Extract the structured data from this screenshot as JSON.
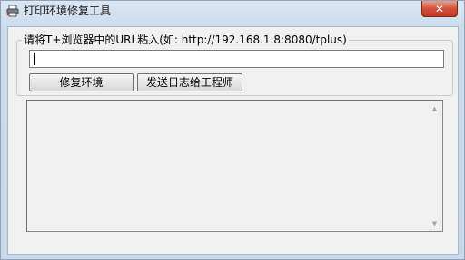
{
  "window": {
    "title": "打印环境修复工具",
    "close_label": "✕"
  },
  "group": {
    "legend": "请将T+浏览器中的URL粘入(如: http://192.168.1.8:8080/tplus)"
  },
  "url_input": {
    "value": ""
  },
  "buttons": {
    "repair_label": "修复环境",
    "send_log_label": "发送日志给工程师"
  },
  "log": {
    "text": ""
  },
  "icons": {
    "app": "printer-icon",
    "close": "close-icon",
    "scroll_up": "scroll-up-arrow-icon",
    "scroll_down": "scroll-down-arrow-icon"
  },
  "colors": {
    "titlebar": "#cddcec",
    "client_bg": "#f0f0f0",
    "close_button": "#d4523a"
  }
}
